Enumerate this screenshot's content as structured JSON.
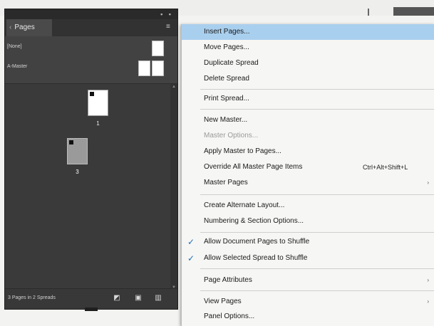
{
  "panel": {
    "tab_label": "Pages",
    "tab_chevron": "chevron-left-icon",
    "masters": [
      {
        "label": "[None]",
        "thumbs": 1
      },
      {
        "label": "A-Master",
        "thumbs": 2
      }
    ],
    "pages": [
      {
        "label": "1",
        "selected": false
      },
      {
        "label": "3",
        "selected": true
      }
    ],
    "status_text": "3 Pages in 2 Spreads",
    "status_buttons": [
      "edit-page-size-icon",
      "new-page-icon",
      "delete-page-icon"
    ]
  },
  "menu": {
    "items": [
      {
        "id": "insert-pages",
        "label": "Insert Pages...",
        "highlighted": true
      },
      {
        "id": "move-pages",
        "label": "Move Pages..."
      },
      {
        "id": "duplicate-spread",
        "label": "Duplicate Spread"
      },
      {
        "id": "delete-spread",
        "label": "Delete Spread"
      },
      {
        "id": "print-spread",
        "label": "Print Spread..."
      },
      {
        "id": "new-master",
        "label": "New Master..."
      },
      {
        "id": "master-options",
        "label": "Master Options...",
        "disabled": true
      },
      {
        "id": "apply-master",
        "label": "Apply Master to Pages..."
      },
      {
        "id": "override-all",
        "label": "Override All Master Page Items",
        "shortcut": "Ctrl+Alt+Shift+L"
      },
      {
        "id": "master-pages",
        "label": "Master Pages",
        "submenu": true
      },
      {
        "id": "create-alternate",
        "label": "Create Alternate Layout..."
      },
      {
        "id": "numbering-section",
        "label": "Numbering & Section Options..."
      },
      {
        "id": "allow-doc-shuffle",
        "label": "Allow Document Pages to Shuffle",
        "checked": true
      },
      {
        "id": "allow-spread-shuffle",
        "label": "Allow Selected Spread to Shuffle",
        "checked": true
      },
      {
        "id": "page-attributes",
        "label": "Page Attributes",
        "submenu": true
      },
      {
        "id": "view-pages",
        "label": "View Pages",
        "submenu": true
      },
      {
        "id": "panel-options",
        "label": "Panel Options..."
      }
    ],
    "check_glyph": "✓",
    "submenu_glyph": "›"
  },
  "colors": {
    "highlight": "#a9cfee",
    "panel_bg": "#3a3a3a",
    "menu_bg": "#f6f6f4",
    "check": "#1f6fbf"
  }
}
